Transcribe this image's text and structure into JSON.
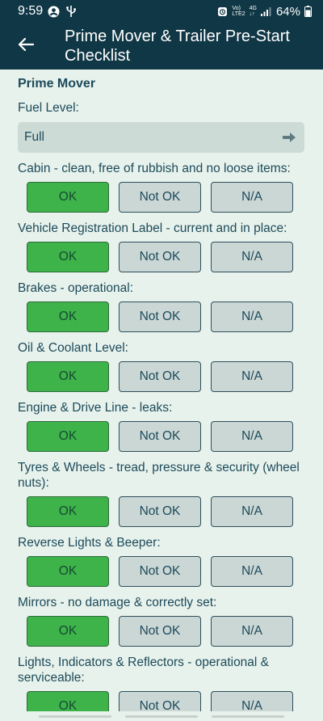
{
  "status_bar": {
    "time": "9:59",
    "network_top": "Vo)",
    "network_bottom": "LTE2",
    "signal_top": "4G",
    "signal_bottom": "↓↑",
    "battery": "64%"
  },
  "header": {
    "title": "Prime Mover & Trailer Pre-Start Checklist",
    "back_icon": "arrow-left-icon"
  },
  "section": {
    "title": "Prime Mover"
  },
  "fuel": {
    "label": "Fuel Level:",
    "value": "Full",
    "icon": "arrow-right-icon"
  },
  "option_labels": [
    "OK",
    "Not OK",
    "N/A"
  ],
  "questions": [
    {
      "label": "Cabin - clean, free of rubbish and no loose items:",
      "selected": "OK"
    },
    {
      "label": "Vehicle Registration Label - current and in place:",
      "selected": "OK"
    },
    {
      "label": "Brakes - operational:",
      "selected": "OK"
    },
    {
      "label": "Oil & Coolant Level:",
      "selected": "OK"
    },
    {
      "label": "Engine & Drive Line - leaks:",
      "selected": "OK"
    },
    {
      "label": "Tyres & Wheels - tread, pressure & security (wheel nuts):",
      "selected": "OK"
    },
    {
      "label": "Reverse Lights & Beeper:",
      "selected": "OK"
    },
    {
      "label": "Mirrors - no damage & correctly set:",
      "selected": "OK"
    },
    {
      "label": "Lights, Indicators & Reflectors - operational & serviceable:",
      "selected": "OK"
    }
  ],
  "colors": {
    "header_bg": "#103746",
    "content_bg": "#e7f2ec",
    "selected_bg": "#3db34a",
    "option_bg": "#cbd7d5",
    "text": "#1d4a5a"
  }
}
